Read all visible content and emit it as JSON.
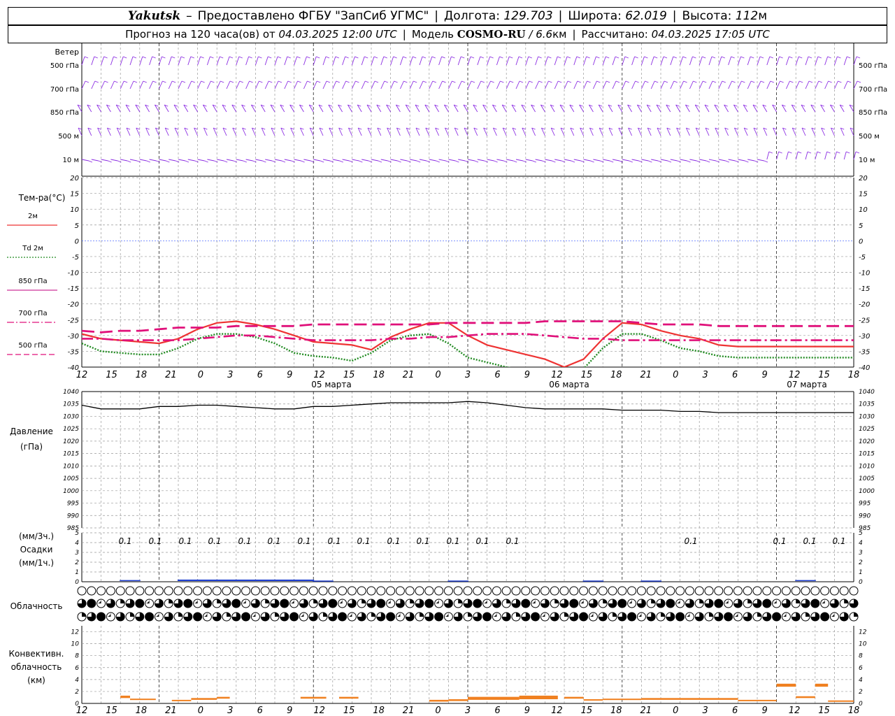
{
  "header": {
    "station": "Yakutsk",
    "dash": "–",
    "provider": "Предоставлено ФГБУ \"ЗапСиб УГМС\"",
    "lon_label": "Долгота:",
    "lon_value": "129.703",
    "lat_label": "Широта:",
    "lat_value": "62.019",
    "alt_label": "Высота:",
    "alt_value": "112",
    "alt_unit": "м",
    "forecast_label": "Прогноз на 120 часа(ов) от",
    "forecast_from": "04.03.2025 12:00 UTC",
    "model_label": "Модель",
    "model_name": "COSMO-RU",
    "model_res": "/ 6.6",
    "model_res_unit": "км",
    "calc_label": "Рассчитано:",
    "calc_time": "04.03.2025 17:05 UTC",
    "separator": "|"
  },
  "wind_panel": {
    "title": "Ветер",
    "levels": [
      "500 гПа",
      "700 гПа",
      "850 гПа",
      "500 м",
      "10  м"
    ],
    "color": "#8a2be2"
  },
  "temp_panel": {
    "title": "Тем-ра(°C)",
    "legend": [
      {
        "label": "2м",
        "color": "#ee3333",
        "style": "solid"
      },
      {
        "label": "Td  2м",
        "color": "#228b22",
        "style": "dotted"
      },
      {
        "label": "850 гПа",
        "color": "#cc3399",
        "style": "solid"
      },
      {
        "label": "700 гПа",
        "color": "#e0107a",
        "style": "dashdot"
      },
      {
        "label": "500 гПа",
        "color": "#e0107a",
        "style": "dashed"
      }
    ],
    "yticks": [
      "20",
      "15",
      "10",
      "5",
      "0",
      "-5",
      "-10",
      "-15",
      "-20",
      "-25",
      "-30",
      "-35",
      "-40"
    ]
  },
  "time_axis": {
    "hour_labels": [
      "12",
      "15",
      "18",
      "21",
      "0",
      "3",
      "6",
      "9",
      "12",
      "15",
      "18",
      "21",
      "0",
      "3",
      "6",
      "9",
      "12",
      "15",
      "18",
      "21",
      "0",
      "3",
      "6",
      "9",
      "12",
      "15",
      "18"
    ],
    "day_labels": [
      "05 марта",
      "06 марта",
      "07 марта"
    ]
  },
  "pressure_panel": {
    "title": "Давление",
    "unit": "(гПа)",
    "yticks": [
      "1040",
      "1035",
      "1030",
      "1025",
      "1020",
      "1015",
      "1010",
      "1005",
      "1000",
      "995",
      "990",
      "985"
    ]
  },
  "precip_panel": {
    "unit_top": "(мм/3ч.)",
    "title": "Осадки",
    "unit_bottom": "(мм/1ч.)",
    "yticks": [
      "5",
      "4",
      "3",
      "2",
      "1",
      "0"
    ],
    "totals": [
      "0.1",
      "0.1",
      "0.1",
      "0.1",
      "0.1",
      "0.1",
      "0.1",
      "0.1",
      "0.1",
      "0.1",
      "0.1",
      "0.1",
      "0.1",
      "0.1",
      "0.1",
      "0.1",
      "0.1",
      "0.1"
    ]
  },
  "cloud_panel": {
    "title": "Облачность"
  },
  "conv_panel": {
    "title_lines": [
      "Конвективн.",
      "облачность",
      "(км)"
    ],
    "yticks": [
      "12",
      "10",
      "8",
      "6",
      "4",
      "2",
      "0"
    ],
    "color": "#f08020"
  },
  "chart_data": [
    {
      "type": "line",
      "title": "Тем-ра(°C)",
      "x": [
        0,
        3,
        6,
        9,
        12,
        15,
        18,
        21,
        24,
        27,
        30,
        33,
        36,
        39,
        42,
        45,
        48,
        51,
        54,
        57,
        60,
        63,
        66,
        69,
        72,
        75,
        78,
        81,
        84,
        87,
        90,
        93,
        96,
        99,
        102,
        105,
        108,
        111,
        114,
        117,
        120
      ],
      "ylim": [
        -40,
        20
      ],
      "series": [
        {
          "name": "2м",
          "values": [
            -29.5,
            -31,
            -31.5,
            -32,
            -32.5,
            -31,
            -28,
            -26,
            -25.5,
            -26.5,
            -28,
            -30,
            -32,
            -32.5,
            -33,
            -34.5,
            -30.5,
            -28,
            -26,
            -26,
            -30,
            -33,
            -34.5,
            -36,
            -37.5,
            -40,
            -37.5,
            -31,
            -26,
            -26.5,
            -28.5,
            -30,
            -31,
            -33,
            -33.5,
            -33.5,
            -33.5,
            -33.5,
            -33.5,
            -33.5,
            -33.5
          ]
        },
        {
          "name": "Td  2м",
          "values": [
            -32.5,
            -35,
            -35.5,
            -36,
            -36,
            -34,
            -31,
            -29.5,
            -29.5,
            -30.5,
            -32.5,
            -35.5,
            -36.5,
            -37,
            -38,
            -35.5,
            -31.5,
            -30,
            -29.5,
            -32.5,
            -37,
            -38.5,
            -40,
            -41,
            -42,
            -44,
            -40.5,
            -34,
            -29.5,
            -29.5,
            -31.5,
            -34,
            -35,
            -36.5,
            -37,
            -37,
            -37,
            -37,
            -37,
            -37,
            -37
          ]
        },
        {
          "name": "700 гПа",
          "values": [
            -31,
            -31,
            -31.5,
            -31.5,
            -31.5,
            -31.5,
            -31,
            -30.5,
            -30,
            -30,
            -30.5,
            -31,
            -31.5,
            -31.5,
            -31.5,
            -31.5,
            -31,
            -31,
            -30.5,
            -30.5,
            -30,
            -29.5,
            -29.5,
            -29.5,
            -30,
            -30.5,
            -31,
            -31,
            -31.5,
            -31.5,
            -31.5,
            -31.5,
            -31.5,
            -31.5,
            -31.5,
            -31.5,
            -31.5,
            -31.5,
            -31.5,
            -31.5,
            -31.5
          ]
        },
        {
          "name": "500 гПа",
          "values": [
            -28.5,
            -29,
            -28.5,
            -28.5,
            -28,
            -27.5,
            -27.5,
            -27.5,
            -27,
            -27,
            -27,
            -27,
            -26.5,
            -26.5,
            -26.5,
            -26.5,
            -26.5,
            -26.5,
            -26.5,
            -26,
            -26,
            -26,
            -26,
            -26,
            -25.5,
            -25.5,
            -25.5,
            -25.5,
            -25.5,
            -26,
            -26.5,
            -26.5,
            -26.5,
            -27,
            -27,
            -27,
            -27,
            -27,
            -27,
            -27,
            -27
          ]
        }
      ]
    },
    {
      "type": "line",
      "title": "Давление",
      "x": [
        0,
        3,
        6,
        9,
        12,
        15,
        18,
        21,
        24,
        27,
        30,
        33,
        36,
        39,
        42,
        45,
        48,
        51,
        54,
        57,
        60,
        63,
        66,
        69,
        72,
        75,
        78,
        81,
        84,
        87,
        90,
        93,
        96,
        99,
        102,
        105,
        108,
        111,
        114,
        117,
        120
      ],
      "ylim": [
        985,
        1040
      ],
      "series": [
        {
          "name": "Давление",
          "values": [
            1034.5,
            1033,
            1033,
            1033,
            1034,
            1034,
            1034.5,
            1034.5,
            1034,
            1033.5,
            1033,
            1033,
            1034,
            1034,
            1034.5,
            1035,
            1035.5,
            1035.5,
            1035.5,
            1035.5,
            1036,
            1035.5,
            1034.5,
            1033.5,
            1033,
            1033,
            1033,
            1033,
            1032.5,
            1032.5,
            1032.5,
            1032,
            1032,
            1031.5,
            1031.5,
            1031.5,
            1031.5,
            1031.5,
            1031.5,
            1031.5,
            1031.5
          ]
        }
      ]
    },
    {
      "type": "bar",
      "title": "Осадки",
      "ylim": [
        0,
        5
      ],
      "series": [
        {
          "name": "мм/1ч.",
          "x_hours": [
            6,
            15,
            18,
            21,
            24,
            27,
            30,
            33,
            36,
            57,
            78,
            87,
            111
          ],
          "values": [
            0.1,
            0.15,
            0.15,
            0.15,
            0.15,
            0.15,
            0.15,
            0.15,
            0.05,
            0.05,
            0.05,
            0.05,
            0.1
          ]
        }
      ]
    },
    {
      "type": "bar",
      "title": "Конвективн. облачность",
      "ylim": [
        0,
        13
      ],
      "series": [
        {
          "name": "км",
          "segments": [
            {
              "x0": 6,
              "x1": 7.5,
              "y0": 0.9,
              "y1": 1.3
            },
            {
              "x0": 7.5,
              "x1": 11.5,
              "y0": 0.6,
              "y1": 0.8
            },
            {
              "x0": 14,
              "x1": 17,
              "y0": 0.4,
              "y1": 0.6
            },
            {
              "x0": 17,
              "x1": 21,
              "y0": 0.6,
              "y1": 0.9
            },
            {
              "x0": 21,
              "x1": 23,
              "y0": 0.8,
              "y1": 1.1
            },
            {
              "x0": 34,
              "x1": 38,
              "y0": 0.8,
              "y1": 1.1
            },
            {
              "x0": 40,
              "x1": 43,
              "y0": 0.8,
              "y1": 1.1
            },
            {
              "x0": 54,
              "x1": 57,
              "y0": 0.3,
              "y1": 0.6
            },
            {
              "x0": 57,
              "x1": 60,
              "y0": 0.4,
              "y1": 0.7
            },
            {
              "x0": 60,
              "x1": 68,
              "y0": 0.6,
              "y1": 1.1
            },
            {
              "x0": 68,
              "x1": 74,
              "y0": 0.7,
              "y1": 1.3
            },
            {
              "x0": 75,
              "x1": 78,
              "y0": 0.8,
              "y1": 1.1
            },
            {
              "x0": 78,
              "x1": 81,
              "y0": 0.5,
              "y1": 0.7
            },
            {
              "x0": 81,
              "x1": 87,
              "y0": 0.6,
              "y1": 0.8
            },
            {
              "x0": 87,
              "x1": 102,
              "y0": 0.6,
              "y1": 0.9
            },
            {
              "x0": 102,
              "x1": 108,
              "y0": 0.4,
              "y1": 0.6
            },
            {
              "x0": 108,
              "x1": 111,
              "y0": 2.8,
              "y1": 3.3
            },
            {
              "x0": 111,
              "x1": 114,
              "y0": 0.9,
              "y1": 1.2
            },
            {
              "x0": 114,
              "x1": 116,
              "y0": 2.8,
              "y1": 3.3
            },
            {
              "x0": 116,
              "x1": 120,
              "y0": 0.3,
              "y1": 0.5
            }
          ]
        }
      ]
    }
  ]
}
